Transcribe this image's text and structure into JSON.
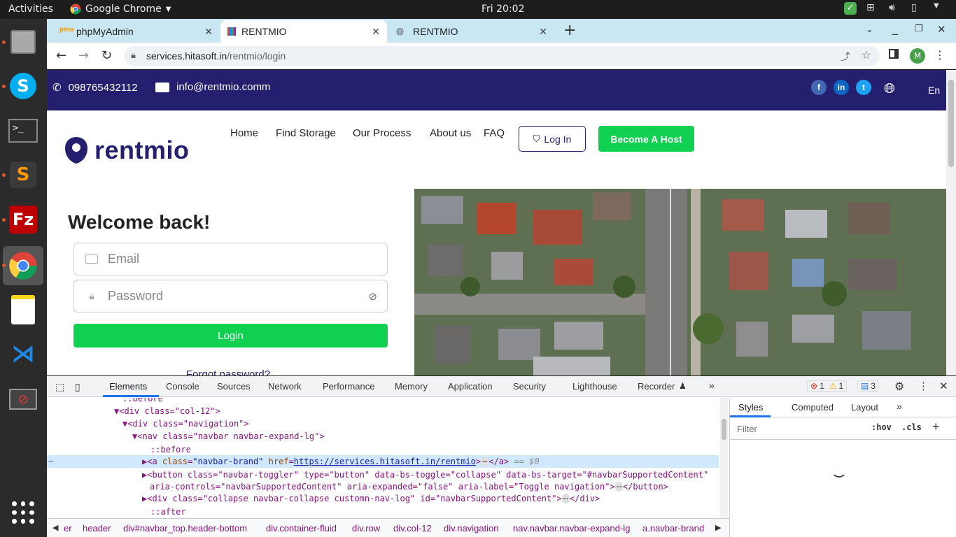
{
  "topbar": {
    "activities": "Activities",
    "app_name": "Google Chrome",
    "clock": "Fri 20:02"
  },
  "dock": {
    "items": [
      "files-icon",
      "skype-icon",
      "terminal-icon",
      "sublime-text-icon",
      "filezilla-icon",
      "chrome-icon",
      "notes-icon",
      "vscode-icon",
      "screen-recorder-icon",
      "app-grid-icon"
    ]
  },
  "chrome": {
    "tabs": [
      {
        "label": "phpMyAdmin",
        "close": "✕"
      },
      {
        "label": "RENTMIO",
        "close": "✕"
      },
      {
        "label": "RENTMIO",
        "close": "✕"
      }
    ],
    "new_tab": "+",
    "url_host": "services.hitasoft.in",
    "url_path": "/rentmio/login",
    "profile_initial": "M"
  },
  "site": {
    "phone": "098765432112",
    "email": "info@rentmio.comm",
    "language": "En",
    "logo_text": "rentmio",
    "nav": [
      "Home",
      "Find Storage",
      "Our Process",
      "About us",
      "FAQ"
    ],
    "login_button": "Log In",
    "host_button": "Become A Host",
    "welcome": "Welcome back!",
    "email_placeholder": "Email",
    "password_placeholder": "Password",
    "submit": "Login",
    "forgot": "Forgot password?",
    "colors": {
      "brand_navy": "#241f6e",
      "brand_green": "#10d050"
    }
  },
  "devtools": {
    "tabs": [
      "Elements",
      "Console",
      "Sources",
      "Network",
      "Performance",
      "Memory",
      "Application",
      "Security",
      "Lighthouse",
      "Recorder"
    ],
    "errors": "1",
    "warnings": "1",
    "messages": "3",
    "dom_lines": [
      "::before",
      "<div class=\"col-12\">",
      "<div class=\"navigation\">",
      "<nav class=\"navbar navbar-expand-lg\">",
      "::before",
      "::after"
    ],
    "brand_link_href": "https://services.hitasoft.in/rentmio",
    "selected_suffix": "== $0",
    "toggler_line1_a": "<button class=\"navbar-toggler\" type=\"button\" data-bs-toggle=\"collapse\" data-bs-target=\"#navbarSupportedContent\"",
    "toggler_line2": "aria-controls=\"navbarSupportedContent\" aria-expanded=\"false\" aria-label=\"Toggle navigation\">",
    "toggler_close": "</button>",
    "collapse_line": "<div class=\"collapse navbar-collapse customn-nav-log\" id=\"navbarSupportedContent\">",
    "collapse_close": "</div>",
    "breadcrumbs": [
      "er",
      "header",
      "div#navbar_top.header-bottom",
      "div.container-fluid",
      "div.row",
      "div.col-12",
      "div.navigation",
      "nav.navbar.navbar-expand-lg",
      "a.navbar-brand"
    ],
    "styles_tabs": [
      "Styles",
      "Computed",
      "Layout"
    ],
    "filter_placeholder": "Filter",
    "hov": ":hov",
    "cls": ".cls"
  }
}
